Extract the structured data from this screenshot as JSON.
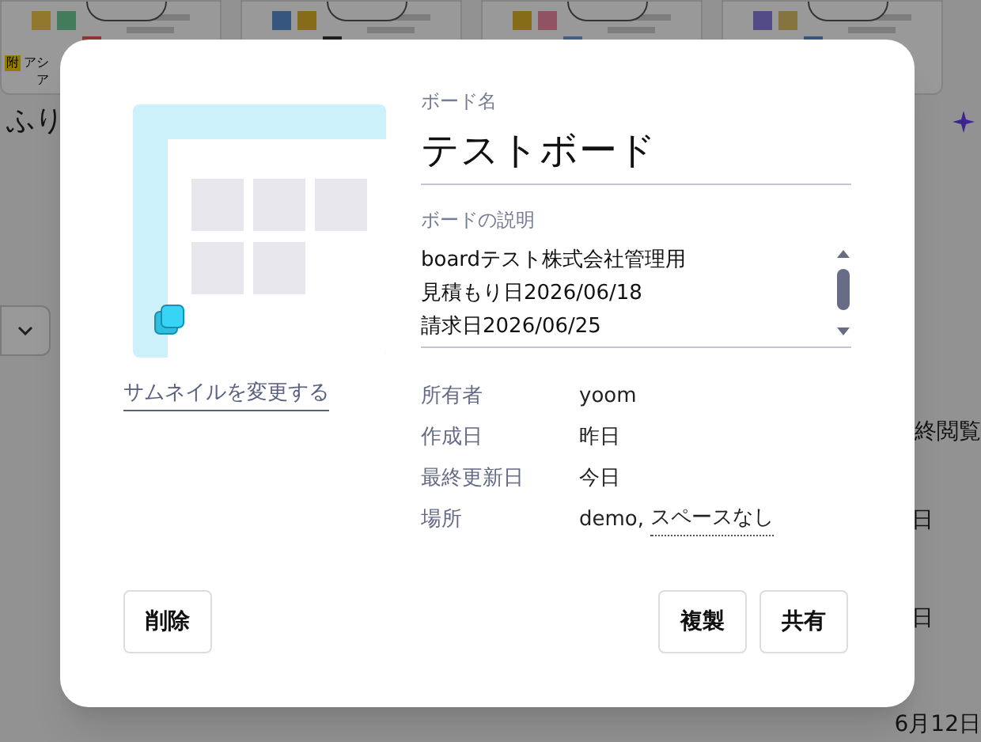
{
  "background": {
    "first_card": {
      "badge": "附",
      "title": "アシ",
      "tag": "ア"
    },
    "heading": "ふり",
    "column_texts": [
      "終閲覧",
      "日",
      "日",
      "6月12日"
    ]
  },
  "dialog": {
    "name_label": "ボード名",
    "name": "テストボード",
    "description_label": "ボードの説明",
    "description_lines": [
      "boardテスト株式会社管理用",
      "見積もり日2026/06/18",
      "請求日2026/06/25"
    ],
    "thumbnail_link": "サムネイルを変更する",
    "details": [
      {
        "label": "所有者",
        "value": "yoom"
      },
      {
        "label": "作成日",
        "value": "昨日"
      },
      {
        "label": "最終更新日",
        "value": "今日"
      },
      {
        "label": "場所",
        "value": "demo,",
        "link": "スペースなし"
      }
    ],
    "left_buttons": [
      "削除"
    ],
    "right_buttons": [
      "複製",
      "共有"
    ]
  }
}
